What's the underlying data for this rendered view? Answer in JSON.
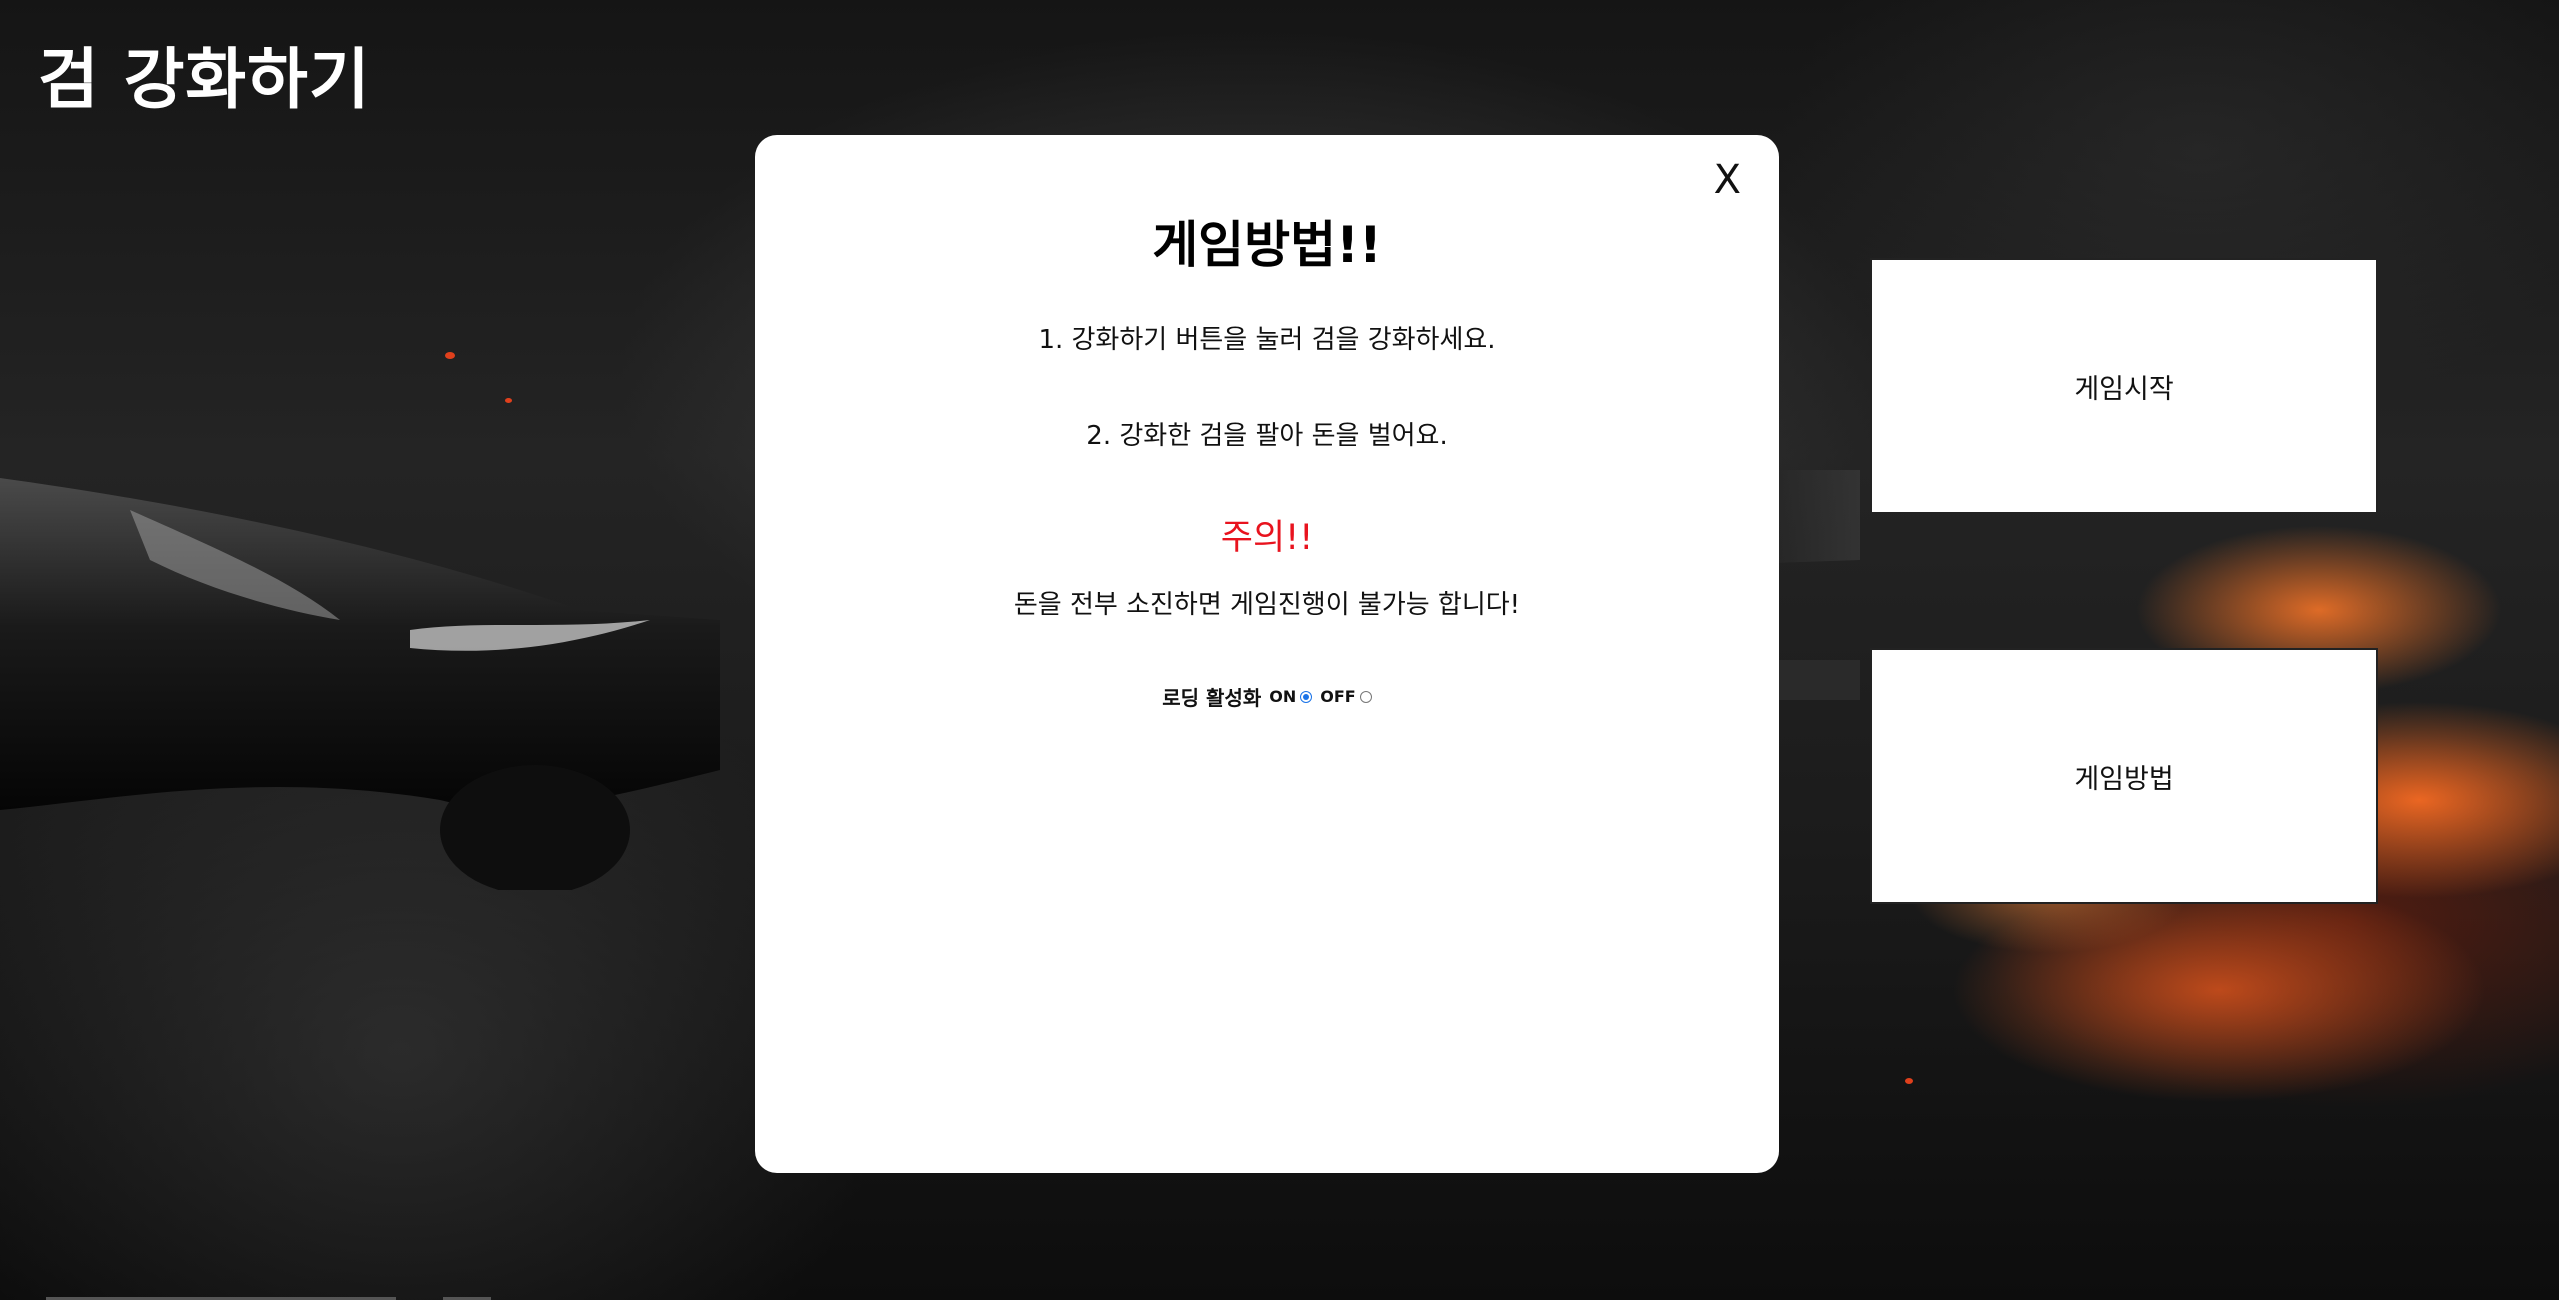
{
  "game": {
    "title": "검 강화하기"
  },
  "menu": {
    "start_label": "게임시작",
    "howto_label": "게임방법"
  },
  "modal": {
    "close_label": "X",
    "title": "게임방법!!",
    "rules": [
      "1. 강화하기 버튼을 눌러 검을 강화하세요.",
      "2. 강화한 검을 팔아 돈을 벌어요."
    ],
    "warning_title": "주의!!",
    "warning_text": "돈을 전부 소진하면 게임진행이 불가능 합니다!",
    "loading": {
      "label": "로딩 활성화",
      "on_label": "ON",
      "off_label": "OFF",
      "selected": "ON"
    }
  },
  "colors": {
    "warning": "#e8131e",
    "radio_selected": "#1a73e8"
  }
}
